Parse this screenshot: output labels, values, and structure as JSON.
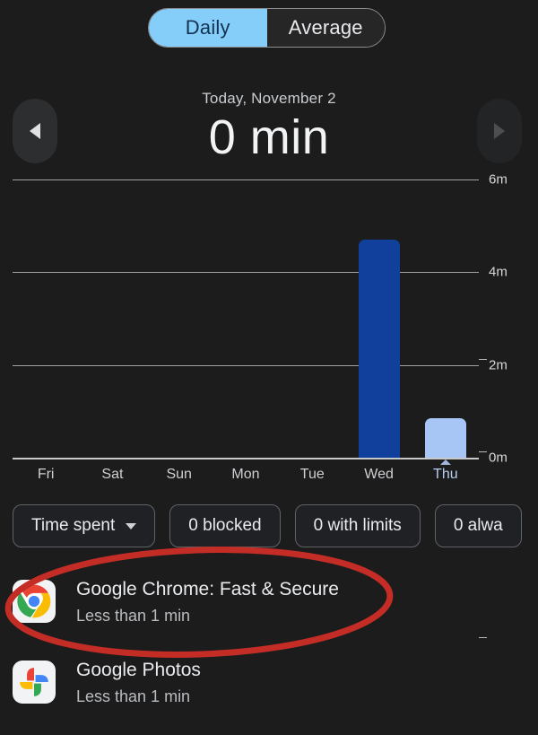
{
  "toggle": {
    "options": [
      {
        "label": "Daily",
        "selected": true
      },
      {
        "label": "Average",
        "selected": false
      }
    ]
  },
  "header": {
    "date": "Today, November 2",
    "value": "0 min",
    "prev_icon": "chevron-left-icon",
    "next_icon": "chevron-right-icon"
  },
  "chart_data": {
    "type": "bar",
    "title": "",
    "xlabel": "",
    "ylabel": "",
    "categories": [
      "Fri",
      "Sat",
      "Sun",
      "Mon",
      "Tue",
      "Wed",
      "Thu"
    ],
    "values": [
      0,
      0,
      0,
      0,
      0,
      4.7,
      0.85
    ],
    "unit": "m",
    "ylim": [
      0,
      6
    ],
    "yticks": [
      "0m",
      "2m",
      "4m",
      "6m"
    ],
    "ytick_values": [
      0,
      2,
      4,
      6
    ],
    "grid": true,
    "legend": "none",
    "selected_category": "Thu",
    "colors": {
      "bar": "#10409C",
      "bar_selected": "#A8C6F5",
      "grid": "#b6b8ba",
      "axis": "#c6c8ca",
      "background": "#1c1c1c"
    }
  },
  "filters": {
    "chips": [
      {
        "label": "Time spent",
        "has_dropdown": true
      },
      {
        "label": "0 blocked",
        "has_dropdown": false
      },
      {
        "label": "0 with limits",
        "has_dropdown": false
      },
      {
        "label": "0 alwa",
        "has_dropdown": false
      }
    ]
  },
  "apps": [
    {
      "name": "Google Chrome: Fast & Secure",
      "usage": "Less than 1 min",
      "icon": "chrome-icon"
    },
    {
      "name": "Google Photos",
      "usage": "Less than 1 min",
      "icon": "google-photos-icon"
    }
  ],
  "annotation": {
    "shape": "ellipse",
    "color": "#C32D26",
    "target": "Google Chrome: Fast & Secure"
  }
}
